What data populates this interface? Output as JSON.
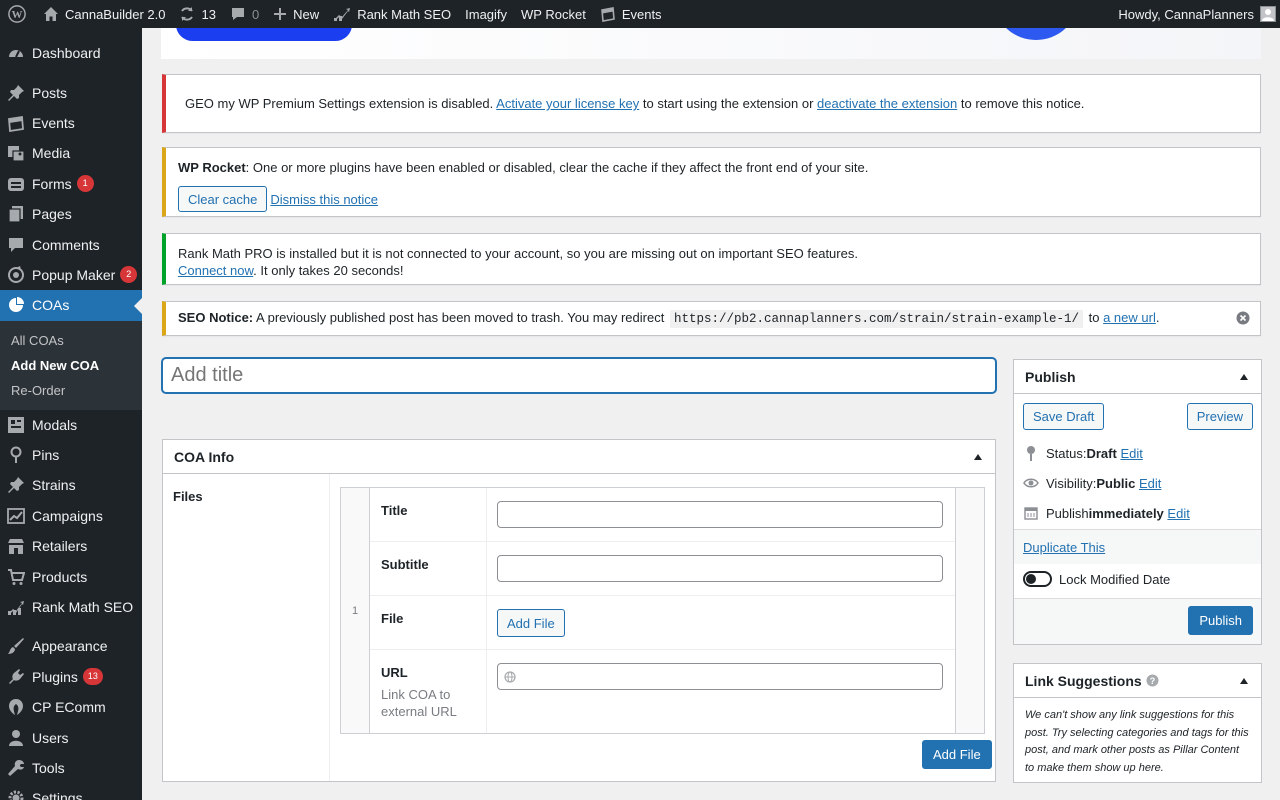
{
  "adminbar": {
    "site_name": "CannaBuilder 2.0",
    "updates_count": "13",
    "comments_count": "0",
    "new_label": "New",
    "rankmath_label": "Rank Math SEO",
    "imagify_label": "Imagify",
    "wprocket_label": "WP Rocket",
    "events_label": "Events",
    "howdy": "Howdy, CannaPlanners"
  },
  "sidebar": {
    "items": [
      {
        "label": "Dashboard",
        "icon": "dashboard-icon"
      },
      {
        "label": "Posts",
        "icon": "pin-icon"
      },
      {
        "label": "Events",
        "icon": "calendar-icon"
      },
      {
        "label": "Media",
        "icon": "media-icon"
      },
      {
        "label": "Forms",
        "icon": "forms-icon",
        "badge": "1"
      },
      {
        "label": "Pages",
        "icon": "pages-icon"
      },
      {
        "label": "Comments",
        "icon": "comments-icon"
      },
      {
        "label": "Popup Maker",
        "icon": "popup-icon",
        "badge": "2"
      },
      {
        "label": "COAs",
        "icon": "pie-chart-icon"
      },
      {
        "label": "Modals",
        "icon": "modals-icon"
      },
      {
        "label": "Pins",
        "icon": "location-icon"
      },
      {
        "label": "Strains",
        "icon": "pin-icon"
      },
      {
        "label": "Campaigns",
        "icon": "campaigns-icon"
      },
      {
        "label": "Retailers",
        "icon": "store-icon"
      },
      {
        "label": "Products",
        "icon": "cart-icon"
      },
      {
        "label": "Rank Math SEO",
        "icon": "rankmath-icon"
      },
      {
        "label": "Appearance",
        "icon": "brush-icon"
      },
      {
        "label": "Plugins",
        "icon": "plugins-icon",
        "badge": "13"
      },
      {
        "label": "CP EComm",
        "icon": "ecomm-icon"
      },
      {
        "label": "Users",
        "icon": "users-icon"
      },
      {
        "label": "Tools",
        "icon": "tools-icon"
      },
      {
        "label": "Settings",
        "icon": "settings-icon"
      }
    ],
    "submenu": [
      "All COAs",
      "Add New COA",
      "Re-Order"
    ]
  },
  "notices": {
    "geo": {
      "text1": "GEO my WP Premium Settings extension is disabled. ",
      "link1": "Activate your license key",
      "text2": " to start using the extension or ",
      "link2": "deactivate the extension",
      "text3": " to remove this notice."
    },
    "rocket": {
      "strong": "WP Rocket",
      "text": ": One or more plugins have been enabled or disabled, clear the cache if they affect the front end of your site.",
      "clear_button": "Clear cache",
      "dismiss_link": "Dismiss this notice"
    },
    "rankmath": {
      "text": "Rank Math PRO is installed but it is not connected to your account, so you are missing out on important SEO features.",
      "link": "Connect now",
      "text2": ". It only takes 20 seconds!"
    },
    "seo": {
      "strong": "SEO Notice:",
      "text": " A previously published post has been moved to trash. You may redirect ",
      "code": "https://pb2.cannaplanners.com/strain/strain-example-1/",
      "text2": " to ",
      "link": "a new url",
      "text3": "."
    }
  },
  "editor": {
    "title_placeholder": "Add title"
  },
  "coa_info": {
    "title": "COA Info",
    "files_label": "Files",
    "row_number": "1",
    "fields": {
      "title_label": "Title",
      "subtitle_label": "Subtitle",
      "file_label": "File",
      "add_file_inner": "Add File",
      "url_label": "URL",
      "url_desc": "Link COA to external URL"
    },
    "add_file_button": "Add File"
  },
  "publish": {
    "title": "Publish",
    "save_draft": "Save Draft",
    "preview": "Preview",
    "status_label": "Status: ",
    "status_value": "Draft",
    "visibility_label": "Visibility: ",
    "visibility_value": "Public",
    "publish_label": "Publish ",
    "publish_value": "immediately",
    "edit": "Edit",
    "duplicate": "Duplicate This",
    "lock_modified": "Lock Modified Date",
    "publish_button": "Publish"
  },
  "link_suggestions": {
    "title": "Link Suggestions",
    "text": "We can't show any link suggestions for this post. Try selecting categories and tags for this post, and mark other posts as Pillar Content to make them show up here."
  }
}
